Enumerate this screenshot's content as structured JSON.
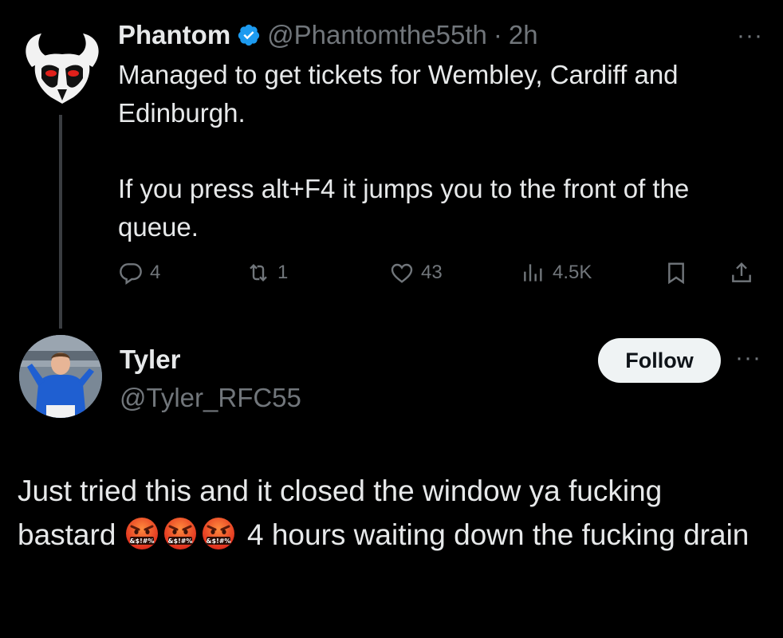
{
  "tweet": {
    "author_name": "Phantom",
    "verified": true,
    "handle": "@Phantomthe55th",
    "separator": "·",
    "time": "2h",
    "more": "···",
    "text_paragraphs": [
      "Managed to get tickets for Wembley, Cardiff and Edinburgh.",
      "If you press alt+F4 it jumps you to the front of the queue."
    ],
    "actions": {
      "replies": "4",
      "reposts": "1",
      "likes": "43",
      "views": "4.5K"
    },
    "avatar_icon": "devil-mask-icon"
  },
  "reply": {
    "author_name": "Tyler",
    "handle": "@Tyler_RFC55",
    "follow_label": "Follow",
    "more": "···",
    "avatar_icon": "footballer-photo",
    "text_part1": "Just tried this and it closed the window ya fucking bastard",
    "emoji_name": "face-with-symbols-on-mouth",
    "emoji_count": 3,
    "text_part2": "4 hours waiting down the fucking drain"
  },
  "colors": {
    "background": "#000000",
    "text_primary": "#e7e9ea",
    "text_secondary": "#71767b",
    "verified_blue": "#1d9bf0",
    "thread_line": "#3a3d41",
    "follow_bg": "#eff3f4"
  }
}
